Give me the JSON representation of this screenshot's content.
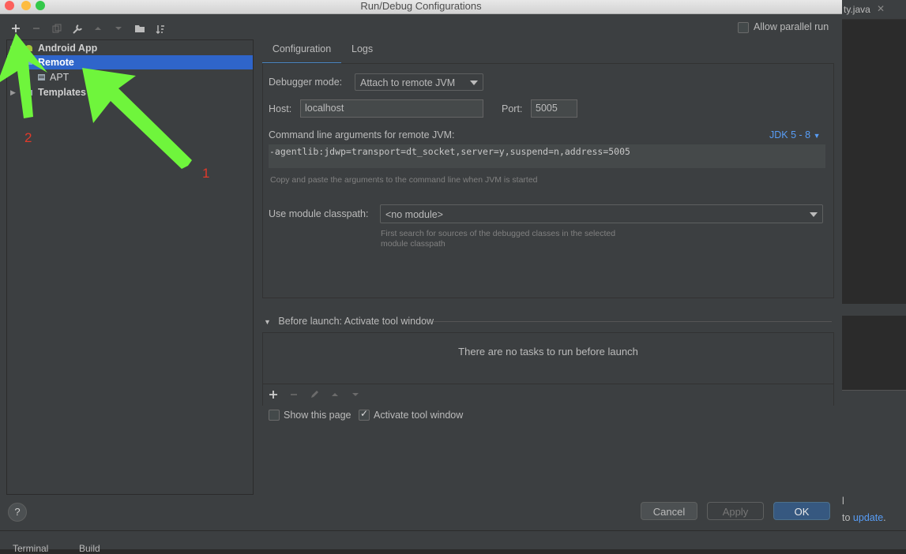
{
  "background_ide": {
    "tab_label": "ty.java",
    "tab_close": "✕",
    "notification_line1": "l",
    "notification_prefix": "to",
    "notification_link": "update",
    "notification_suffix": ".",
    "bottom_items": [
      "Terminal",
      "Build"
    ]
  },
  "dialog": {
    "title": "Run/Debug Configurations",
    "allow_parallel_label": "Allow parallel run",
    "allow_parallel_checked": false
  },
  "tree": {
    "items": [
      {
        "label": "Android App",
        "icon": "android-icon",
        "expanded": false
      },
      {
        "label": "Remote",
        "icon": "remote-icon",
        "selected": true
      },
      {
        "label": "APT",
        "icon": "config-file-icon"
      },
      {
        "label": "Templates",
        "icon": "templates-icon",
        "expanded": false
      }
    ]
  },
  "tabs": [
    "Configuration",
    "Logs"
  ],
  "config": {
    "debugger_mode_label": "Debugger mode:",
    "debugger_mode_value": "Attach to remote JVM",
    "host_label": "Host:",
    "host_value": "localhost",
    "port_label": "Port:",
    "port_value": "5005",
    "cmd_label": "Command line arguments for remote JVM:",
    "jdk_link": "JDK 5 - 8",
    "cmd_value": "-agentlib:jdwp=transport=dt_socket,server=y,suspend=n,address=5005",
    "cmd_hint": "Copy and paste the arguments to the command line when JVM is started",
    "module_label": "Use module classpath:",
    "module_value": "<no module>",
    "module_hint_1": "First search for sources of the debugged classes in the selected",
    "module_hint_2": "module classpath"
  },
  "before_launch": {
    "header": "Before launch: Activate tool window",
    "empty_text": "There are no tasks to run before launch",
    "show_page_label": "Show this page",
    "show_page_checked": false,
    "activate_label": "Activate tool window",
    "activate_checked": true
  },
  "buttons": {
    "cancel": "Cancel",
    "apply": "Apply",
    "ok": "OK",
    "help": "?"
  },
  "annotations": {
    "label_1": "1",
    "label_2": "2",
    "arrow_color": "#6ff53c"
  },
  "colors": {
    "selection": "#2f65ca",
    "link": "#589df6",
    "ok_button": "#365880"
  }
}
